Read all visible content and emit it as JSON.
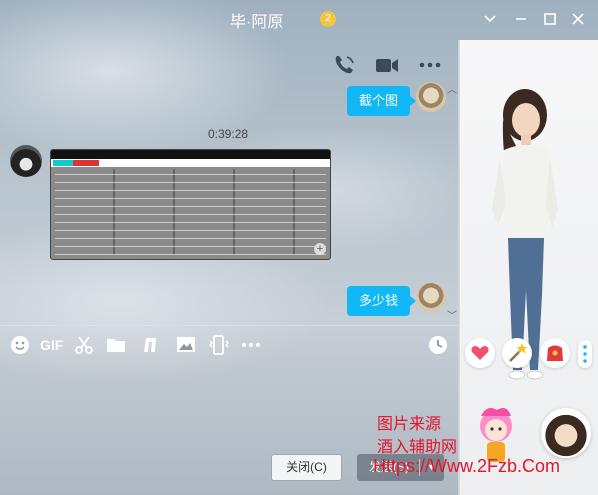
{
  "window": {
    "title": "毕·阿原",
    "title_badge": "2"
  },
  "header": {
    "icons": [
      "phone-icon",
      "video-icon",
      "more-icon"
    ]
  },
  "messages": [
    {
      "type": "text",
      "from": "self",
      "text": "截个图"
    },
    {
      "type": "timestamp",
      "text": "0:39:28"
    },
    {
      "type": "image",
      "from": "peer"
    },
    {
      "type": "text",
      "from": "self",
      "text": "多少钱"
    }
  ],
  "toolbar": {
    "gif_label": "GIF",
    "icons": [
      "emoji-icon",
      "gif-icon",
      "scissors-icon",
      "folder-icon",
      "music-note-icon",
      "picture-icon",
      "shake-icon",
      "more-icon",
      "history-clock-icon"
    ]
  },
  "buttons": {
    "close_label": "关闭(C)",
    "send_label": "发送(S)"
  },
  "watermark": {
    "line1": "图片来源",
    "line2": "酒入辅助网",
    "line3": "Https://Www.2Fzb.Com"
  },
  "colors": {
    "bubble": "#12b7f5",
    "watermark": "#e6142b"
  }
}
